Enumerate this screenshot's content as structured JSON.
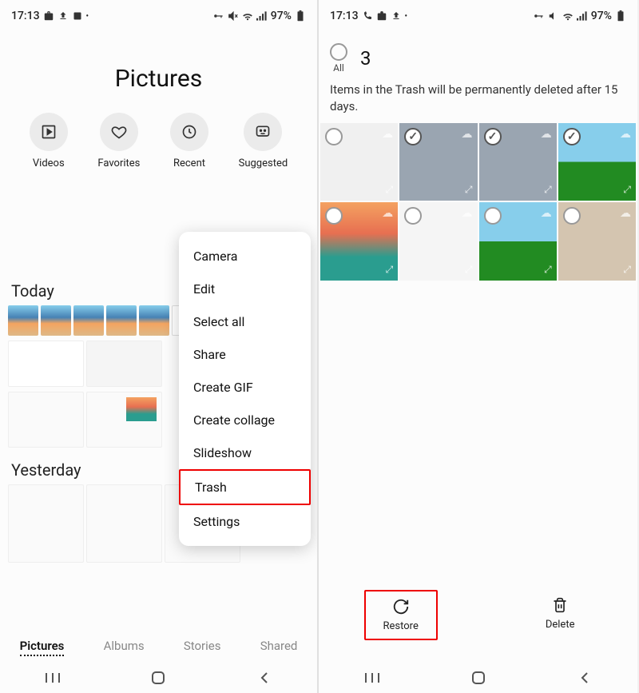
{
  "status": {
    "time": "17:13",
    "battery": "97%"
  },
  "left": {
    "title": "Pictures",
    "quick": [
      {
        "label": "Videos"
      },
      {
        "label": "Favorites"
      },
      {
        "label": "Recent"
      },
      {
        "label": "Suggested"
      }
    ],
    "sections": [
      "Today",
      "Yesterday"
    ],
    "menu": [
      "Camera",
      "Edit",
      "Select all",
      "Share",
      "Create GIF",
      "Create collage",
      "Slideshow",
      "Trash",
      "Settings"
    ],
    "tabs": [
      "Pictures",
      "Albums",
      "Stories",
      "Shared"
    ]
  },
  "right": {
    "all_label": "All",
    "selected_count": "3",
    "info": "Items in the Trash will be permanently deleted after 15 days.",
    "thumbs": [
      {
        "checked": false
      },
      {
        "checked": true
      },
      {
        "checked": true
      },
      {
        "checked": true
      },
      {
        "checked": false
      },
      {
        "checked": false
      },
      {
        "checked": false
      },
      {
        "checked": false
      }
    ],
    "actions": {
      "restore": "Restore",
      "delete": "Delete"
    }
  }
}
